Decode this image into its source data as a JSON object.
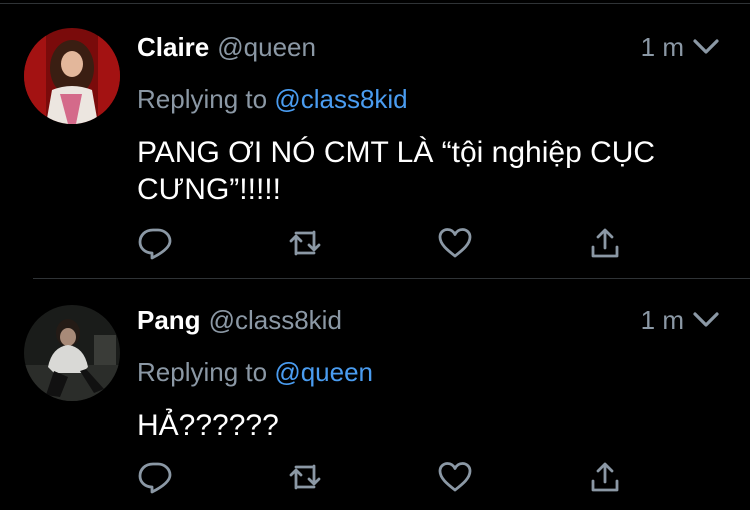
{
  "tweets": [
    {
      "name": "Claire",
      "handle": "@queen",
      "time": "1 m",
      "replying_prefix": "Replying to",
      "replying_to": "@class8kid",
      "text": "PANG ƠI NÓ CMT LÀ “tội nghiệp CỤC CƯNG”!!!!!"
    },
    {
      "name": "Pang",
      "handle": "@class8kid",
      "time": "1 m",
      "replying_prefix": "Replying to",
      "replying_to": "@queen",
      "text": "HẢ??????"
    }
  ],
  "icons": {
    "reply": "reply-icon",
    "retweet": "retweet-icon",
    "like": "heart-icon",
    "share": "share-icon",
    "menu": "chevron-down-icon"
  },
  "colors": {
    "background": "#000000",
    "secondary_text": "#8b98a5",
    "mention": "#4a9cf0",
    "divider": "#2f3336"
  }
}
